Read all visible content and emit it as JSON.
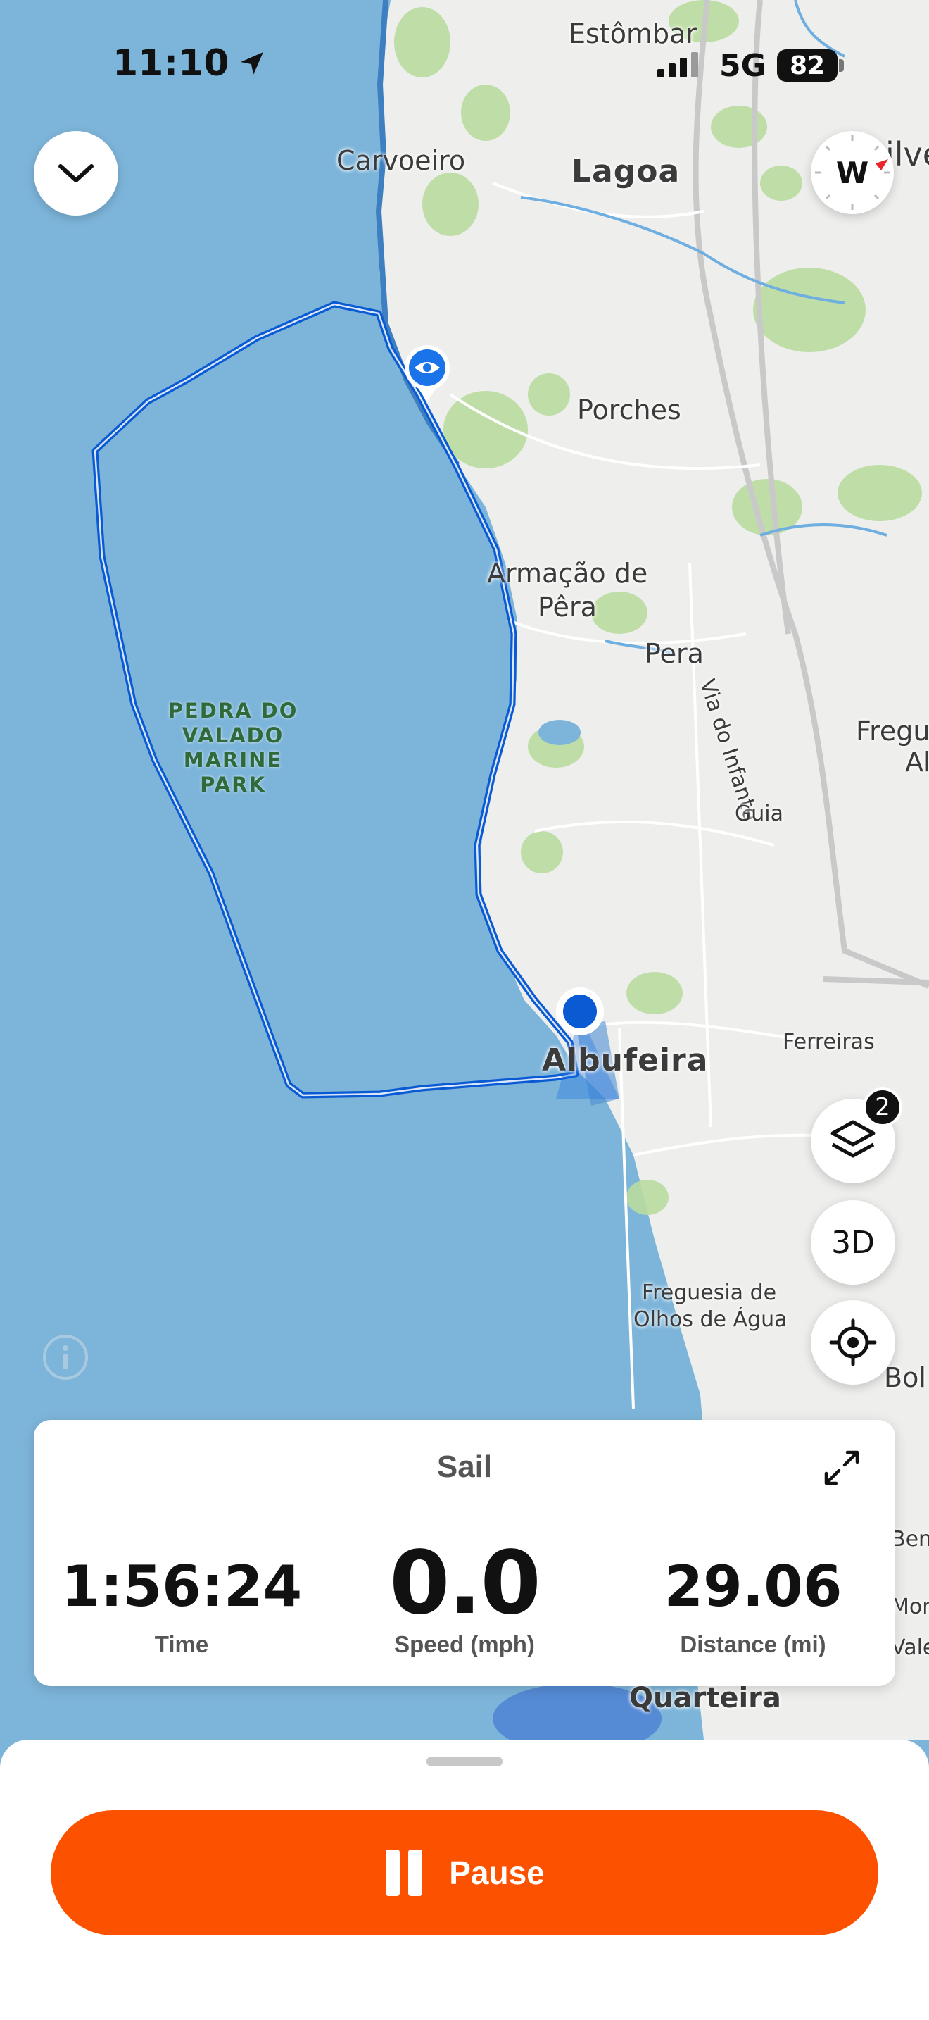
{
  "status_bar": {
    "time": "11:10",
    "network": "5G",
    "battery": "82"
  },
  "map": {
    "labels": {
      "estombar": "Estômbar",
      "carvoeiro": "Carvoeiro",
      "lagoa": "Lagoa",
      "silves_partial": "ilve",
      "porches": "Porches",
      "armacao_line1": "Armação de",
      "armacao_line2": "Pêra",
      "pera": "Pera",
      "via_do_infante": "Via do Infante",
      "fregu_line1": "Fregu",
      "fregu_line2": "Al",
      "guia": "Guia",
      "ferreiras": "Ferreiras",
      "albufeira": "Albufeira",
      "olhos_line1": "Freguesia de",
      "olhos_line2": "Olhos de Água",
      "bol_partial": "Bol",
      "bent_partial": "Bent",
      "mont_partial": "Mont",
      "vale_partial": "Vale",
      "quarteira": "Quarteira"
    },
    "park_label": {
      "line1": "PEDRA DO",
      "line2": "VALADO MARINE",
      "line3": "PARK"
    },
    "icons": {
      "collapse": "chevron-down-icon",
      "compass": "compass-icon",
      "layers": "layers-icon",
      "recenter": "locate-icon",
      "info": "info-icon",
      "start": "eye-icon"
    },
    "compass_letter": "W",
    "layers_badge": "2",
    "btn_3d": "3D"
  },
  "colors": {
    "water": "#7db5da",
    "route": "#0a5bd3",
    "accent": "#fc5200"
  },
  "stats": {
    "activity": "Sail",
    "time": {
      "value": "1:56:24",
      "label": "Time"
    },
    "speed": {
      "value": "0.0",
      "label": "Speed (mph)"
    },
    "distance": {
      "value": "29.06",
      "label": "Distance (mi)"
    }
  },
  "controls": {
    "pause_label": "Pause"
  }
}
